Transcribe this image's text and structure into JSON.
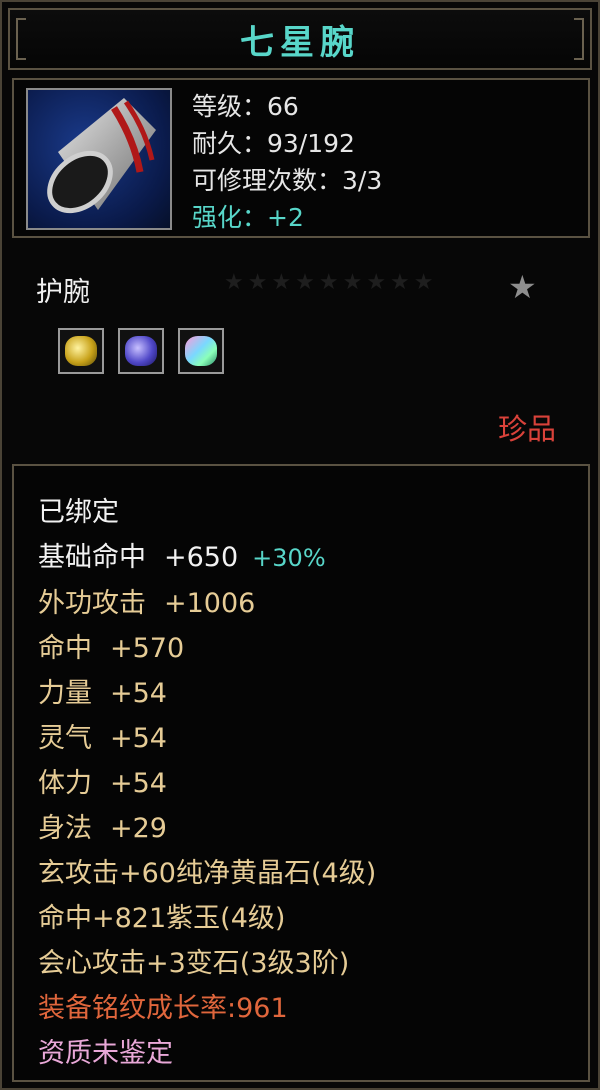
{
  "title": "七星腕",
  "item_icon": "bracer-icon",
  "stats": {
    "level": "等级：66",
    "durability": "耐久：93/192",
    "repairs": "可修理次数：3/3",
    "enhance": "强化：+2"
  },
  "slot_type": "护腕",
  "star_rating": "★★★★★★★★★",
  "star_icon": "★",
  "gems": [
    "yellow-gem-icon",
    "purple-gem-icon",
    "multicolor-gem-icon"
  ],
  "rarity": "珍品",
  "attributes": {
    "bound": "已绑定",
    "base_hit_label": "基础命中",
    "base_hit_value": "+650",
    "base_hit_bonus": "+30%",
    "ext_attack_label": "外功攻击",
    "ext_attack_value": "+1006",
    "hit_label": "命中",
    "hit_value": "+570",
    "strength_label": "力量",
    "strength_value": "+54",
    "spirit_label": "灵气",
    "spirit_value": "+54",
    "stamina_label": "体力",
    "stamina_value": "+54",
    "agility_label": "身法",
    "agility_value": "+29",
    "gem1": "玄攻击+60纯净黄晶石(4级)",
    "gem2": "命中+821紫玉(4级)",
    "gem3": "会心攻击+3变石(3级3阶)",
    "growth": "装备铭纹成长率:961",
    "quality": "资质未鉴定"
  },
  "colors": {
    "title": "#58d6c9",
    "rarity": "#d9423a",
    "gold_text": "#e6cc96",
    "growth_text": "#e0663c",
    "quality_text": "#e9a8d8"
  }
}
